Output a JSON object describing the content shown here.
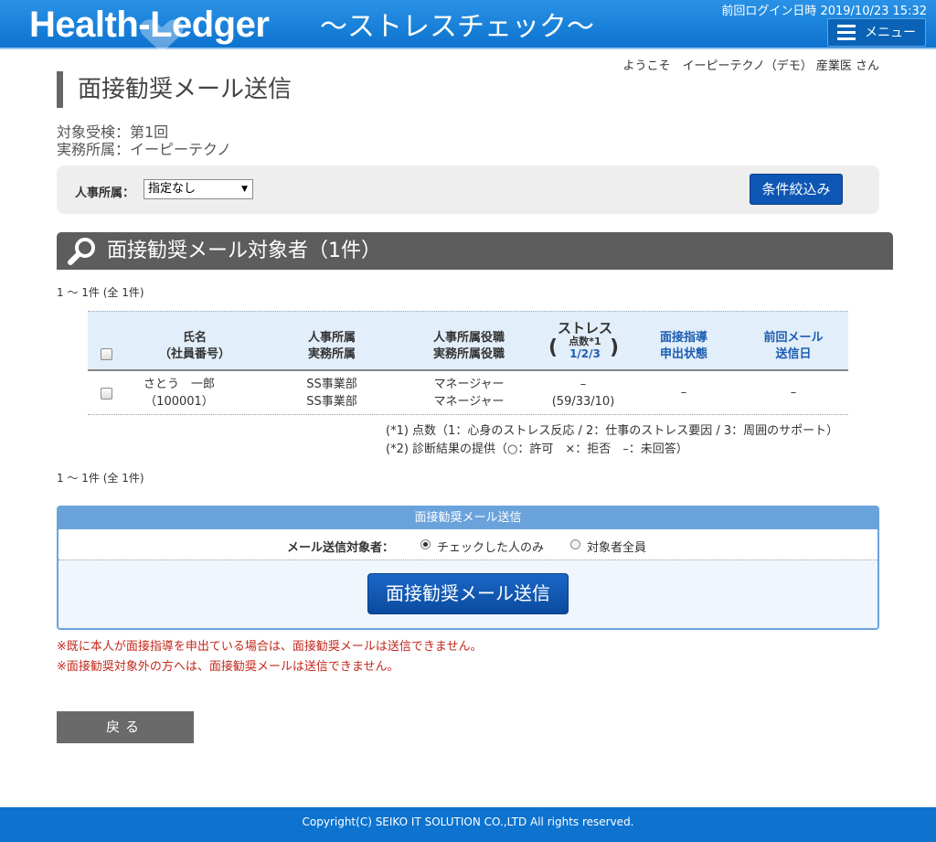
{
  "header": {
    "brand": "Health-Ledger",
    "subtitle": "〜ストレスチェック〜",
    "last_login": "前回ログイン日時 2019/10/23 15:32",
    "menu_label": "メニュー"
  },
  "welcome": "ようこそ　イーピーテクノ（デモ） 産業医 さん",
  "page_title": "面接勧奨メール送信",
  "info": {
    "exam": "対象受検：第1回",
    "office": "実務所属：イーピーテクノ"
  },
  "filter": {
    "label": "人事所属：",
    "selected": "指定なし",
    "button": "条件絞込み"
  },
  "section": {
    "title": "面接勧奨メール対象者（1件）",
    "count_top": "1 〜 1件 (全 1件)",
    "count_bottom": "1 〜 1件 (全 1件)"
  },
  "table": {
    "headers": {
      "name_1": "氏名",
      "name_2": "（社員番号）",
      "dept_1": "人事所属",
      "dept_2": "実務所属",
      "role_1": "人事所属役職",
      "role_2": "実務所属役職",
      "stress_1": "ストレス",
      "stress_2": "点数*1",
      "stress_3": "1/2/3",
      "interview_1": "面接指導",
      "interview_2": "申出状態",
      "lastmail_1": "前回メール",
      "lastmail_2": "送信日"
    },
    "rows": [
      {
        "name": "さとう　一郎",
        "emp_no": "（100001）",
        "hr_dept": "SS事業部",
        "work_dept": "SS事業部",
        "hr_role": "マネージャー",
        "work_role": "マネージャー",
        "stress": "–",
        "scores": "(59/33/10)",
        "interview": "–",
        "last_mail": "–"
      }
    ],
    "notes": [
      "(*1) 点数（1：心身のストレス反応 / 2：仕事のストレス要因 / 3：周囲のサポート）",
      "(*2) 診断結果の提供（○：許可　×：拒否　–：未回答）"
    ]
  },
  "send": {
    "heading": "面接勧奨メール送信",
    "target_label": "メール送信対象者：",
    "option_checked": "チェックした人のみ",
    "option_all": "対象者全員",
    "button": "面接勧奨メール送信"
  },
  "warnings": [
    "※既に本人が面接指導を申出ている場合は、面接勧奨メールは送信できません。",
    "※面接勧奨対象外の方へは、面接勧奨メールは送信できません。"
  ],
  "back_button": "戻る",
  "footer": "Copyright(C) SEIKO IT SOLUTION CO.,LTD All rights reserved."
}
